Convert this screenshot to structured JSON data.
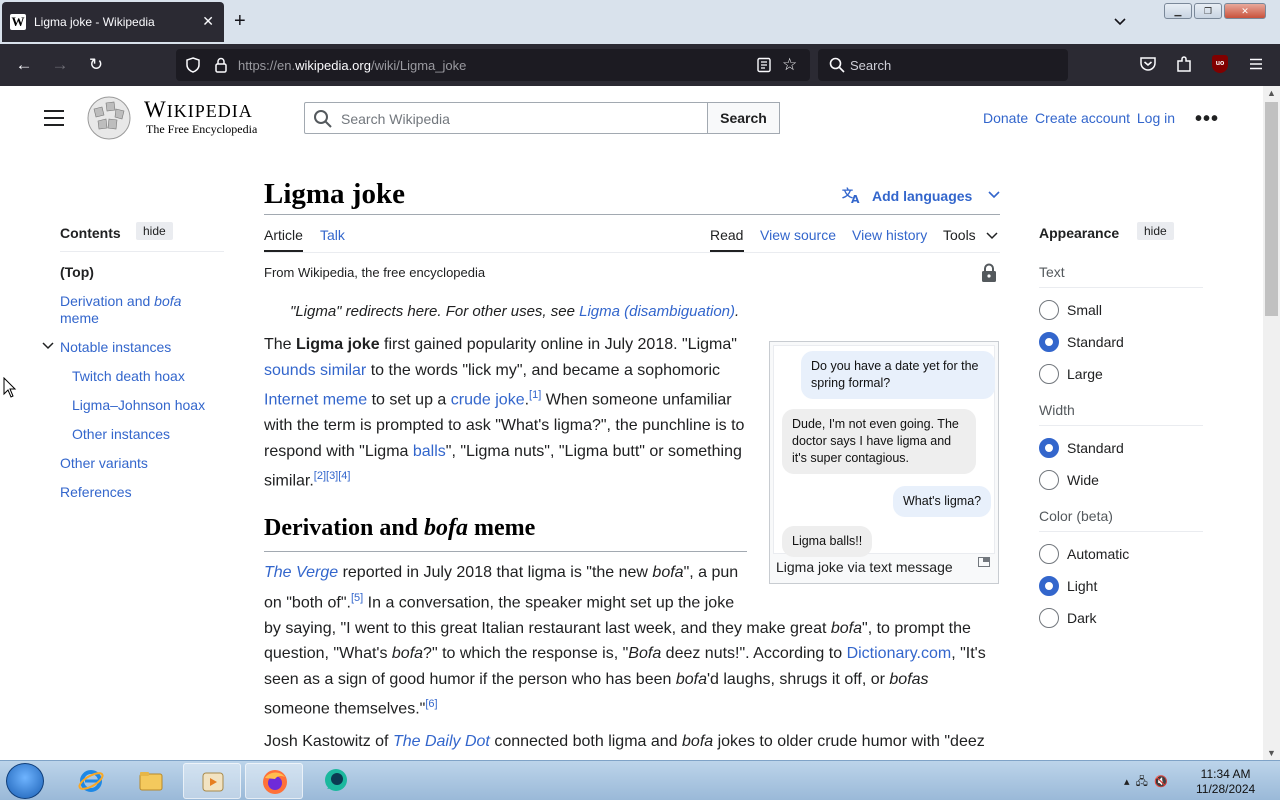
{
  "browser": {
    "tab_title": "Ligma joke - Wikipedia",
    "favicon": "W",
    "url_prefix": "https://en.",
    "url_domain": "wikipedia.org",
    "url_path": "/wiki/Ligma_joke",
    "search_placeholder": "Search",
    "ublock_label": "uo"
  },
  "wiki_header": {
    "wordmark_w": "W",
    "wordmark_rest": "IKIPEDIA",
    "tagline": "The Free Encyclopedia",
    "search_placeholder": "Search Wikipedia",
    "search_button": "Search",
    "donate": "Donate",
    "create_account": "Create account",
    "log_in": "Log in"
  },
  "toc": {
    "title": "Contents",
    "hide": "hide",
    "top": "(Top)",
    "derivation_a": "Derivation and ",
    "derivation_b": "bofa",
    "derivation_c": "meme",
    "notable": "Notable instances",
    "twitch": "Twitch death hoax",
    "ligma_johnson": "Ligma–Johnson hoax",
    "other_instances": "Other instances",
    "other_variants": "Other variants",
    "references": "References"
  },
  "article": {
    "title": "Ligma joke",
    "add_languages": "Add languages",
    "tab_article": "Article",
    "tab_talk": "Talk",
    "tab_read": "Read",
    "tab_view_source": "View source",
    "tab_view_history": "View history",
    "tab_tools": "Tools",
    "from_wp": "From Wikipedia, the free encyclopedia",
    "hatnote_a": "\"Ligma\" redirects here. For other uses, see ",
    "hatnote_link": "Ligma (disambiguation)",
    "hatnote_b": ".",
    "p1": {
      "t1": "The ",
      "b1": "Ligma joke",
      "t2": " first gained popularity online in July 2018. \"Ligma\"",
      "l1": "sounds similar",
      "t3": " to the words \"lick my\", and became a sophomoric",
      "l2": "Internet meme",
      "t4": " to set up a ",
      "l3": "crude joke",
      "t5": ".",
      "ref1": "[1]",
      "t6": " When someone unfamiliar",
      "t7": "with the term is prompted to ask \"What's ligma?\", the punchline is to",
      "t8": "respond with \"Ligma ",
      "l4": "balls",
      "t9": "\", \"Ligma nuts\", \"Ligma butt\" or something",
      "t10": "similar.",
      "ref234": "[2][3][4]"
    },
    "h2_a": "Derivation and ",
    "h2_b": "bofa",
    "h2_c": " meme",
    "p2": {
      "l1": "The Verge",
      "t1": " reported in July 2018 that ligma is \"the new ",
      "i1": "bofa",
      "t2": "\", a pun",
      "t3": "on \"both of\".",
      "ref5": "[5]",
      "t4": " In a conversation, the speaker might set up the joke",
      "t5": "by saying, \"I went to this great Italian restaurant last week, and they make great ",
      "i2": "bofa",
      "t6": "\", to prompt the",
      "t7": "question, \"What's ",
      "i3": "bofa",
      "t8": "?\" to which the response is, \"",
      "i4": "Bofa",
      "t9": " deez nuts!\". According to ",
      "l2": "Dictionary.com",
      "t10": ", \"It's",
      "t11": "seen as a sign of good humor if the person who has been ",
      "i5": "bofa",
      "t12": "'d laughs, shrugs it off, or ",
      "i6": "bofas",
      "t13": "someone themselves.\"",
      "ref6": "[6]"
    },
    "p3": {
      "t1": "Josh Kastowitz of ",
      "l1": "The Daily Dot",
      "t2": " connected both ligma and ",
      "i1": "bofa",
      "t3": " jokes to older crude humor with \"deez"
    },
    "image": {
      "msg1": "Do you have a date yet for the spring formal?",
      "msg2": "Dude, I'm not even going. The doctor says I have ligma and it's super contagious.",
      "msg3": "What's ligma?",
      "msg4": "Ligma balls!!",
      "caption": "Ligma joke via text message"
    }
  },
  "appearance": {
    "title": "Appearance",
    "hide": "hide",
    "text_label": "Text",
    "text_options": [
      "Small",
      "Standard",
      "Large"
    ],
    "text_selected": "Standard",
    "width_label": "Width",
    "width_options": [
      "Standard",
      "Wide"
    ],
    "width_selected": "Standard",
    "color_label": "Color (beta)",
    "color_options": [
      "Automatic",
      "Light",
      "Dark"
    ],
    "color_selected": "Light"
  },
  "taskbar": {
    "time": "11:34 AM",
    "date": "11/28/2024"
  },
  "colors": {
    "link": "#3366cc",
    "browser_chrome": "#2b2a33",
    "taskbar": "#bcd4ea"
  }
}
